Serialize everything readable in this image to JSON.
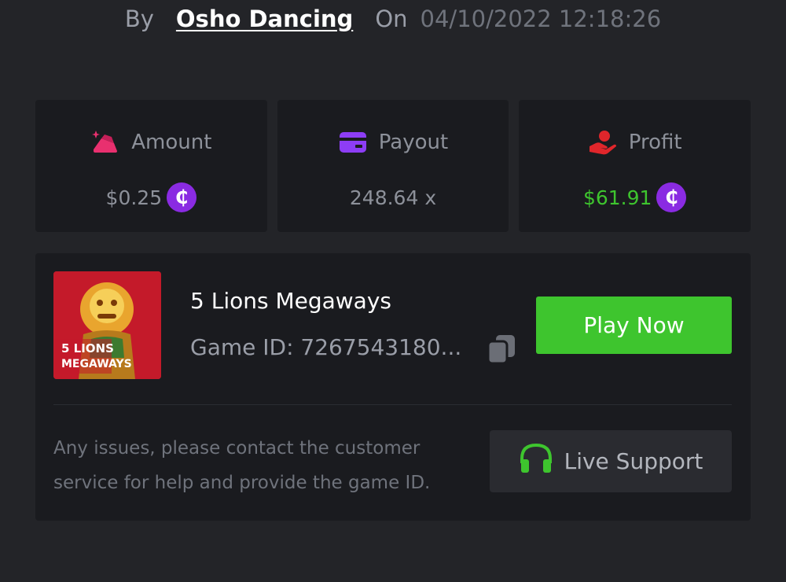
{
  "byline": {
    "by_label": "By",
    "user": "Osho Dancing",
    "on_label": "On",
    "datetime": "04/10/2022 12:18:26"
  },
  "stats": {
    "amount": {
      "label": "Amount",
      "value": "$0.25",
      "icon": "bet-amount-icon",
      "coin_symbol": "₵"
    },
    "payout": {
      "label": "Payout",
      "value": "248.64 x",
      "icon": "wallet-card-icon"
    },
    "profit": {
      "label": "Profit",
      "value": "$61.91",
      "icon": "hand-profit-icon",
      "coin_symbol": "₵"
    }
  },
  "game": {
    "title": "5 Lions Megaways",
    "id_text": "Game ID: 7267543180...",
    "thumbnail_caption_line1": "5 LIONS",
    "thumbnail_caption_line2": "MEGAWAYS",
    "play_label": "Play Now",
    "help_text": "Any issues, please contact the customer service for help and provide the game ID.",
    "support_label": "Live Support"
  },
  "colors": {
    "background": "#232428",
    "card": "#1a1b1f",
    "accent_green": "#3ec52e",
    "coin_purple": "#8a2be2",
    "amount_icon_pink": "#e9306f",
    "payout_icon_purple": "#8d3df5",
    "profit_icon_red": "#e0262b"
  }
}
